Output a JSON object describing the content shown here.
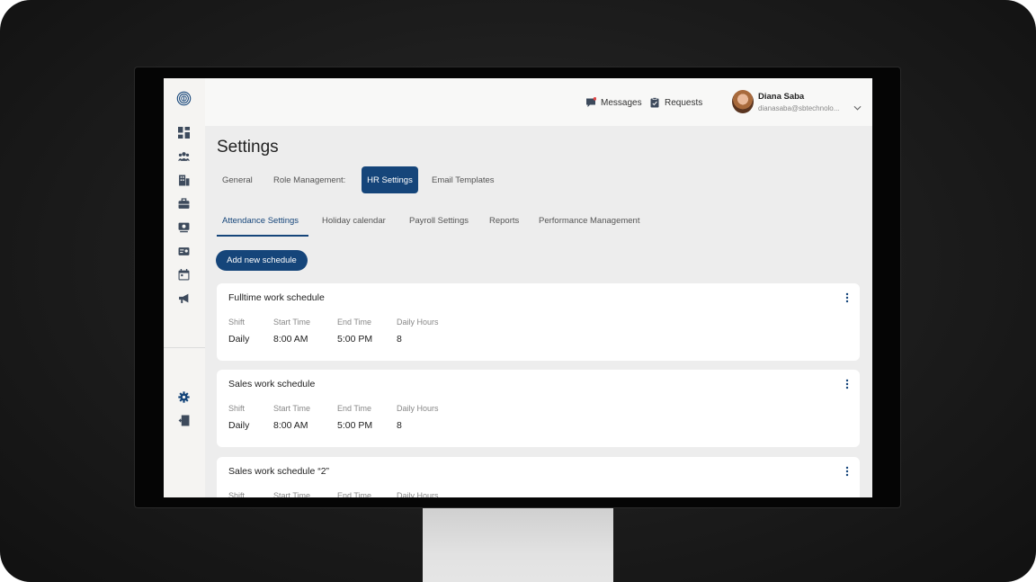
{
  "header": {
    "messages_label": "Messages",
    "requests_label": "Requests",
    "user": {
      "name": "Diana Saba",
      "email": "dianasaba@sbtechnolo..."
    }
  },
  "page": {
    "title": "Settings",
    "tabs": [
      {
        "label": "General"
      },
      {
        "label": "Role Management:"
      },
      {
        "label": "HR Settings",
        "active": true
      },
      {
        "label": "Email Templates"
      }
    ],
    "subtabs": [
      {
        "label": "Attendance Settings",
        "active": true
      },
      {
        "label": "Holiday calendar"
      },
      {
        "label": "Payroll Settings"
      },
      {
        "label": "Reports"
      },
      {
        "label": "Performance Management"
      }
    ],
    "add_button_label": "Add new schedule",
    "columns": {
      "shift": "Shift",
      "start": "Start Time",
      "end": "End Time",
      "hours": "Daily Hours"
    },
    "schedules": [
      {
        "title": "Fulltime work schedule",
        "shift": "Daily",
        "start": "8:00 AM",
        "end": "5:00 PM",
        "hours": "8"
      },
      {
        "title": "Sales work schedule",
        "shift": "Daily",
        "start": "8:00 AM",
        "end": "5:00 PM",
        "hours": "8"
      },
      {
        "title": "Sales work schedule “2”",
        "shift": "",
        "start": "",
        "end": "",
        "hours": ""
      }
    ]
  },
  "sidebar": {
    "icons": [
      "dashboard-icon",
      "people-icon",
      "building-icon",
      "briefcase-icon",
      "payroll-icon",
      "id-card-icon",
      "calendar-icon",
      "megaphone-icon"
    ],
    "bottom_icons": [
      "settings-icon",
      "logout-icon"
    ]
  },
  "colors": {
    "primary": "#15457a",
    "sidebar_icon": "#3d4a5c",
    "background": "#ededed"
  }
}
